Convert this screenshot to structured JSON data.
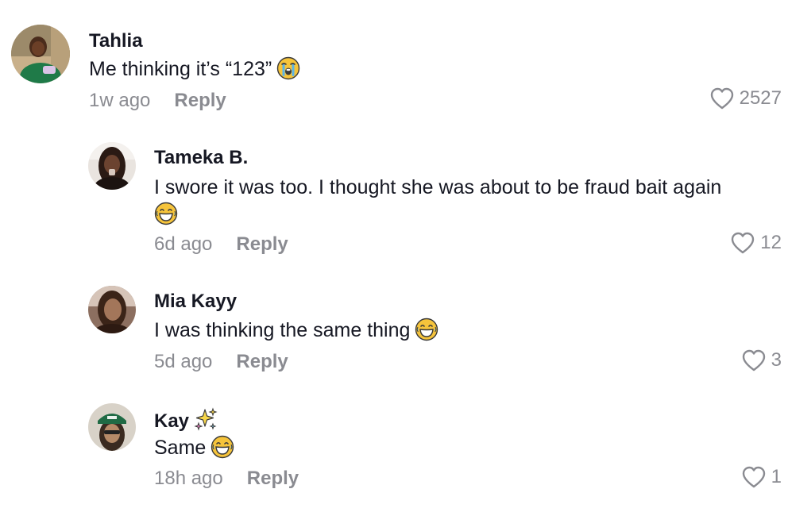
{
  "comments": [
    {
      "author": "Tahlia",
      "text": "Me thinking it’s “123”",
      "emoji": "loudly-crying-face-emoji",
      "time": "1w ago",
      "reply": "Reply",
      "likes": "2527"
    },
    {
      "author": "Tameka B.",
      "text": "I swore it was too. I thought she was about to be fraud bait again",
      "emoji": "face-with-tears-of-joy-emoji",
      "time": "6d ago",
      "reply": "Reply",
      "likes": "12"
    },
    {
      "author": "Mia Kayy",
      "text": "I was thinking the same thing",
      "emoji": "face-with-tears-of-joy-emoji",
      "time": "5d ago",
      "reply": "Reply",
      "likes": "3"
    },
    {
      "author": "Kay",
      "author_badge": "sparkles-emoji",
      "text": "Same",
      "emoji": "face-with-tears-of-joy-emoji",
      "time": "18h ago",
      "reply": "Reply",
      "likes": "1"
    }
  ],
  "colors": {
    "text": "#161823",
    "muted": "#8a8b91",
    "background": "#ffffff"
  }
}
